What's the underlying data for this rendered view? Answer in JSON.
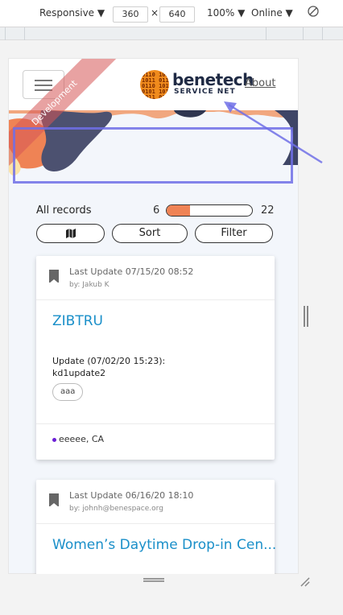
{
  "devtools": {
    "device": "Responsive ▼",
    "width": "360",
    "times": "×",
    "height": "640",
    "zoom": "100% ▼",
    "network": "Online ▼",
    "rotate_icon": "rotate-icon"
  },
  "app": {
    "ribbon_text": "Development",
    "logo_binary": "0110 1010\n1011 0110\n0110 1011\n0101 1010\n1011 0110",
    "logo_name": "benetech",
    "logo_sub": "SERVICE NET",
    "about_link": "About",
    "records": {
      "label": "All records",
      "min": "6",
      "max": "22",
      "fill_fraction": 0.27
    },
    "buttons": {
      "map_icon": "map-icon",
      "sort": "Sort",
      "filter": "Filter"
    },
    "cards": [
      {
        "last_update": "Last Update 07/15/20 08:52",
        "by": "by: Jakub K",
        "title": "ZIBTRU",
        "update_line1": "Update (07/02/20 15:23):",
        "update_line2": "kd1update2",
        "tag": "aaa",
        "location": "eeeee, CA"
      },
      {
        "last_update": "Last Update 06/16/20 18:10",
        "by": "by: johnh@benespace.org",
        "title": "Women’s Daytime Drop-in Cen..."
      }
    ]
  },
  "colors": {
    "accent_blue": "#1a8fc9",
    "slider_fill": "#ef8355",
    "panel_bg": "#f3f6fb",
    "annotation": "#6e6ee6"
  }
}
